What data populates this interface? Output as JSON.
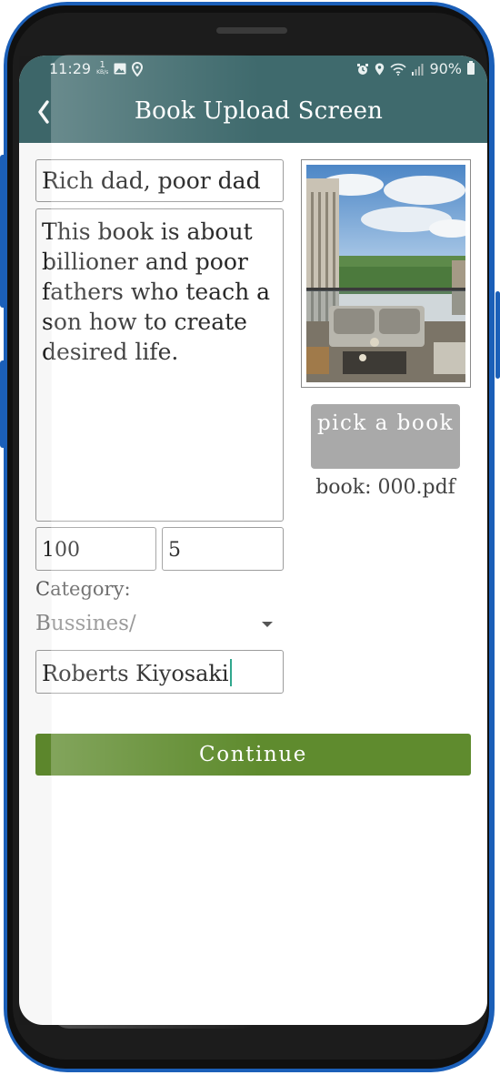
{
  "status_bar": {
    "time": "11:29",
    "speed_value": "1",
    "speed_unit": "KB/s",
    "battery": "90%"
  },
  "app_bar": {
    "title": "Book Upload Screen"
  },
  "form": {
    "title_value": "Rich dad, poor dad",
    "description_value": "This book is about billioner and poor fathers who teach a son how to create desired life.",
    "price_value": "100",
    "quantity_value": "5",
    "category_label": "Category:",
    "category_value": "Bussines/",
    "author_value": "Roberts Kiyosaki"
  },
  "image_panel": {
    "pick_button_label": "pick a book",
    "file_label": "book: 000.pdf"
  },
  "actions": {
    "continue_label": "Continue"
  },
  "colors": {
    "app_bar": "#3f6a6d",
    "continue_button": "#5f8b2e",
    "pick_button": "#a9a9a9",
    "phone_accent": "#1b5fb8"
  }
}
